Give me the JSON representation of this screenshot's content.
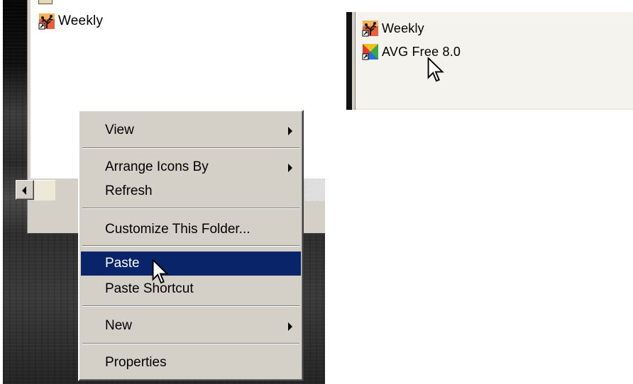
{
  "left_panel": {
    "desktop_items": [
      {
        "label": "Weekly",
        "icon": "weekly-tree-icon"
      }
    ],
    "context_menu": {
      "items": [
        {
          "label": "View",
          "submenu": true,
          "highlighted": false
        },
        {
          "label": "Arrange Icons By",
          "submenu": true,
          "highlighted": false
        },
        {
          "label": "Refresh",
          "submenu": false,
          "highlighted": false
        },
        {
          "label": "Customize This Folder...",
          "submenu": false,
          "highlighted": false
        },
        {
          "label": "Paste",
          "submenu": false,
          "highlighted": true
        },
        {
          "label": "Paste Shortcut",
          "submenu": false,
          "highlighted": false
        },
        {
          "label": "New",
          "submenu": true,
          "highlighted": false
        },
        {
          "label": "Properties",
          "submenu": false,
          "highlighted": false
        }
      ]
    }
  },
  "right_panel": {
    "desktop_items": [
      {
        "label": "Weekly",
        "icon": "weekly-tree-icon"
      },
      {
        "label": "AVG Free 8.0",
        "icon": "avg-shortcut-icon"
      }
    ]
  },
  "colors": {
    "menu_face": "#d4d0c8",
    "menu_highlight": "#0a246a",
    "highlight_text": "#ffffff",
    "window_face": "#d4d0c8"
  }
}
